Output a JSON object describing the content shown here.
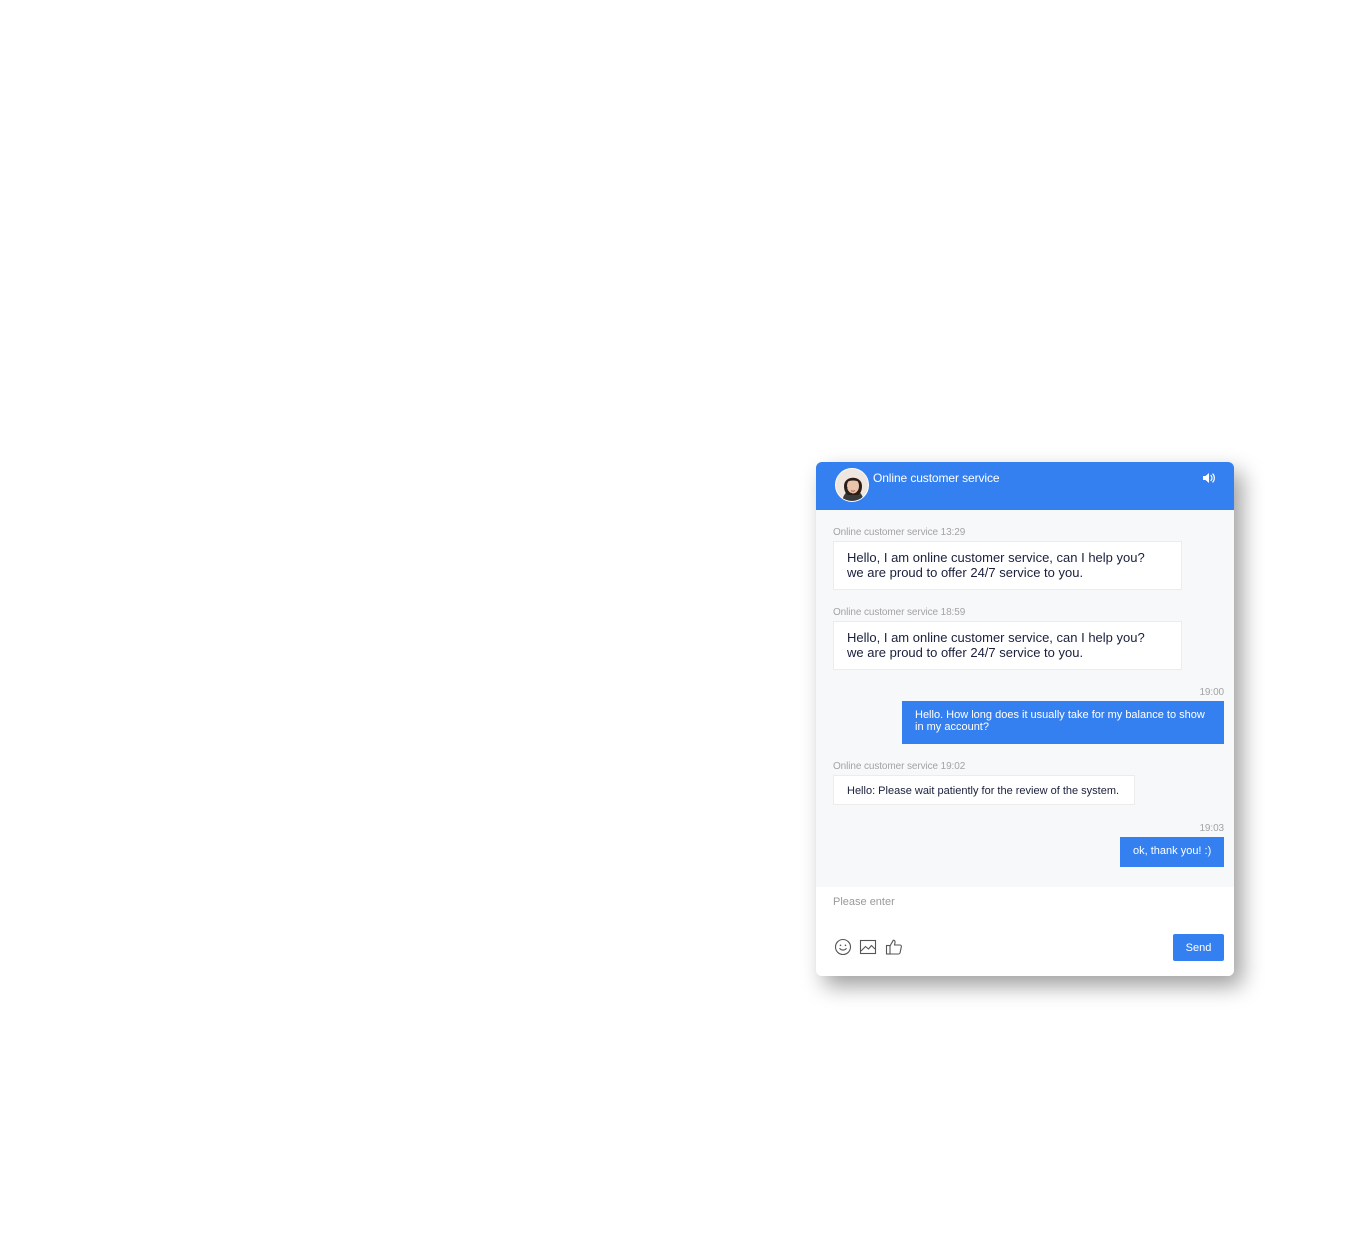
{
  "header": {
    "title": "Online customer service",
    "avatar_icon": "agent-avatar",
    "sound_icon": "speaker-icon"
  },
  "messages": [
    {
      "side": "incoming",
      "meta": "Online customer service 13:29",
      "lines": [
        "Hello, I am online customer service, can I help you?",
        "we are proud to offer 24/7 service to you."
      ]
    },
    {
      "side": "incoming",
      "meta": "Online customer service 18:59",
      "lines": [
        "Hello, I am online customer service, can I help you?",
        "we are proud to offer 24/7 service to you."
      ]
    },
    {
      "side": "outgoing",
      "meta": "19:00",
      "lines": [
        "Hello. How long does it usually take for my balance to show",
        "in my account?"
      ]
    },
    {
      "side": "incoming",
      "meta": "Online customer service 19:02",
      "text": "Hello: Please wait patiently for the review of the system."
    },
    {
      "side": "outgoing",
      "meta": "19:03",
      "text": "ok, thank you! :)"
    }
  ],
  "composer": {
    "placeholder": "Please enter",
    "send_label": "Send",
    "tools": [
      "emoji-icon",
      "image-icon",
      "thumbs-up-icon"
    ]
  },
  "colors": {
    "accent": "#3580f0",
    "panel_background": "#f7f8fa",
    "incoming_text": "#1a1f3c",
    "meta_text": "#a3a3a3"
  }
}
